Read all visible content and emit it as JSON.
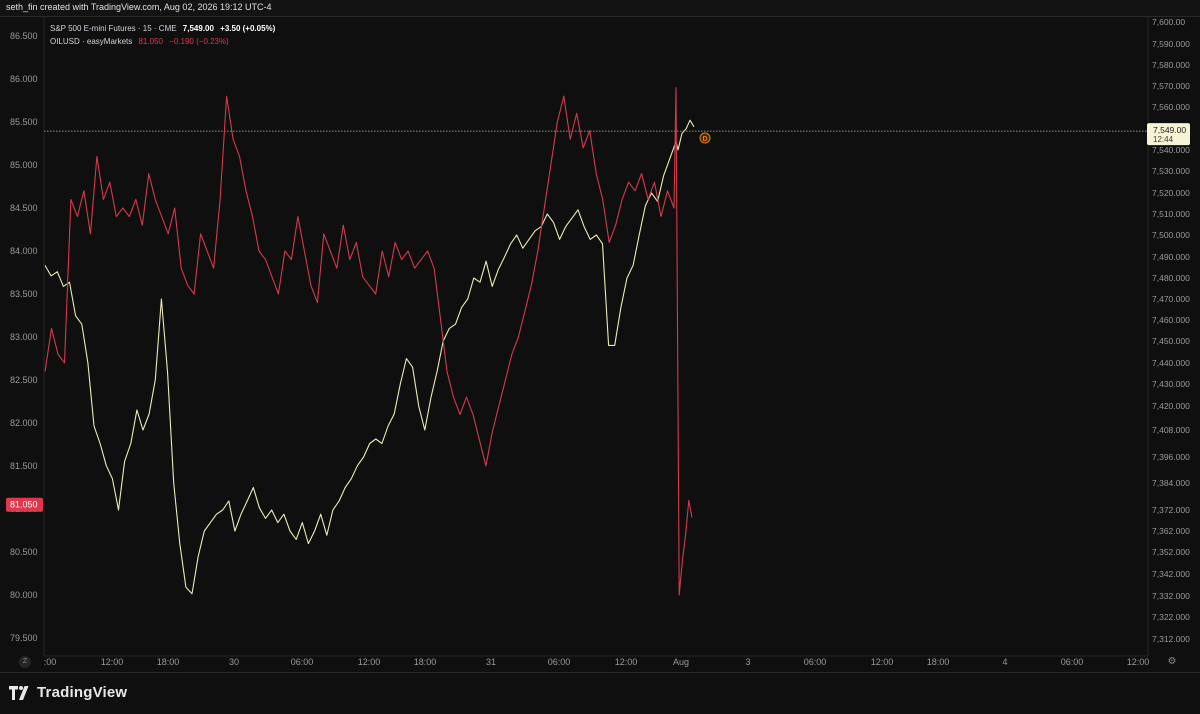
{
  "header": {
    "title": "seth_fin created with TradingView.com, Aug 02, 2026 19:12 UTC-4"
  },
  "legend": {
    "primary": {
      "name": "S&P 500 E-mini Futures · 15 · CME",
      "price": "7,549.00",
      "change": "+3.50 (+0.05%)"
    },
    "secondary": {
      "name": "OILUSD · easyMarkets",
      "price": "81.050",
      "change": "−0.190 (−0.23%)"
    }
  },
  "footer": {
    "brand": "TradingView",
    "zoom_label": "Z"
  },
  "colors": {
    "background": "#0f0f0f",
    "es_line": "#ecebb4",
    "oil_line": "#d53a4c",
    "last_price_tag_bg": "#f6f4d4",
    "oil_tag_bg": "#e0374d",
    "dividend_marker": "#f57c00"
  },
  "chart_data": {
    "type": "line",
    "x_axis_labels": [
      ":00",
      "12:00",
      "18:00",
      "30",
      "06:00",
      "12:00",
      "18:00",
      "31",
      "06:00",
      "12:00",
      "Aug",
      "3",
      "06:00",
      "12:00",
      "18:00",
      "4",
      "06:00",
      "12:00"
    ],
    "right_axis": {
      "ticks": [
        "7,600.00",
        "7,590.000",
        "7,580.000",
        "7,570.000",
        "7,560.000",
        "7,550.000",
        "7,540.000",
        "7,530.000",
        "7,520.000",
        "7,510.000",
        "7,500.000",
        "7,490.000",
        "7,480.000",
        "7,470.000",
        "7,460.000",
        "7,450.000",
        "7,440.000",
        "7,430.000",
        "7,420.000",
        "7,408.000",
        "7,396.000",
        "7,384.000",
        "7,372.000",
        "7,362.000",
        "7,352.000",
        "7,342.000",
        "7,332.000",
        "7,322.000",
        "7,312.000"
      ],
      "last_price_label": "7,549.00",
      "countdown": "12:44"
    },
    "left_axis": {
      "ticks": [
        "86.500",
        "86.000",
        "85.500",
        "85.000",
        "84.500",
        "84.000",
        "83.500",
        "83.000",
        "82.500",
        "82.000",
        "81.500",
        "81.000",
        "80.500",
        "80.000",
        "79.500"
      ],
      "last_price_label": "81.050",
      "ylim": [
        79.3,
        86.7
      ]
    },
    "series": [
      {
        "name": "S&P 500 E-mini Futures",
        "axis": "right",
        "values": [
          7486,
          7481,
          7483,
          7476,
          7478,
          7462,
          7458,
          7440,
          7410,
          7402,
          7392,
          7386,
          7372,
          7394,
          7402,
          7418,
          7408,
          7416,
          7432,
          7470,
          7436,
          7384,
          7356,
          7336,
          7333,
          7350,
          7362,
          7366,
          7370,
          7372,
          7376,
          7362,
          7370,
          7376,
          7382,
          7373,
          7368,
          7372,
          7366,
          7370,
          7362,
          7358,
          7366,
          7356,
          7362,
          7370,
          7360,
          7372,
          7376,
          7382,
          7386,
          7392,
          7396,
          7402,
          7404,
          7402,
          7410,
          7416,
          7430,
          7442,
          7438,
          7420,
          7408,
          7424,
          7436,
          7450,
          7456,
          7458,
          7466,
          7470,
          7480,
          7478,
          7488,
          7476,
          7484,
          7490,
          7496,
          7500,
          7494,
          7498,
          7502,
          7504,
          7510,
          7506,
          7498,
          7504,
          7508,
          7512,
          7504,
          7498,
          7500,
          7496,
          7448,
          7448,
          7466,
          7480,
          7486,
          7500,
          7514,
          7520,
          7516,
          7528,
          7536,
          7544,
          7540,
          7548,
          7550,
          7554,
          7551
        ]
      },
      {
        "name": "OILUSD",
        "axis": "left",
        "values": [
          82.6,
          83.1,
          82.8,
          82.7,
          84.6,
          84.4,
          84.7,
          84.2,
          85.1,
          84.6,
          84.8,
          84.4,
          84.5,
          84.4,
          84.6,
          84.3,
          84.9,
          84.6,
          84.4,
          84.2,
          84.5,
          83.8,
          83.6,
          83.5,
          84.2,
          84.0,
          83.8,
          84.6,
          85.8,
          85.3,
          85.1,
          84.7,
          84.4,
          84.0,
          83.9,
          83.7,
          83.5,
          84.0,
          83.9,
          84.4,
          84.0,
          83.6,
          83.4,
          84.2,
          84.0,
          83.8,
          84.3,
          83.9,
          84.1,
          83.7,
          83.6,
          83.5,
          84.0,
          83.7,
          84.1,
          83.9,
          84.0,
          83.8,
          83.9,
          84.0,
          83.8,
          83.2,
          82.6,
          82.3,
          82.1,
          82.3,
          82.1,
          81.8,
          81.5,
          81.9,
          82.2,
          82.5,
          82.8,
          83.0,
          83.3,
          83.6,
          84.0,
          84.5,
          85.0,
          85.5,
          85.8,
          85.3,
          85.6,
          85.2,
          85.4,
          84.9,
          84.6,
          84.1,
          84.3,
          84.6,
          84.8,
          84.7,
          84.9,
          84.6,
          84.8,
          84.4,
          84.7,
          84.5,
          85.9,
          80.0,
          80.4,
          80.7,
          81.1,
          80.9
        ]
      }
    ]
  }
}
